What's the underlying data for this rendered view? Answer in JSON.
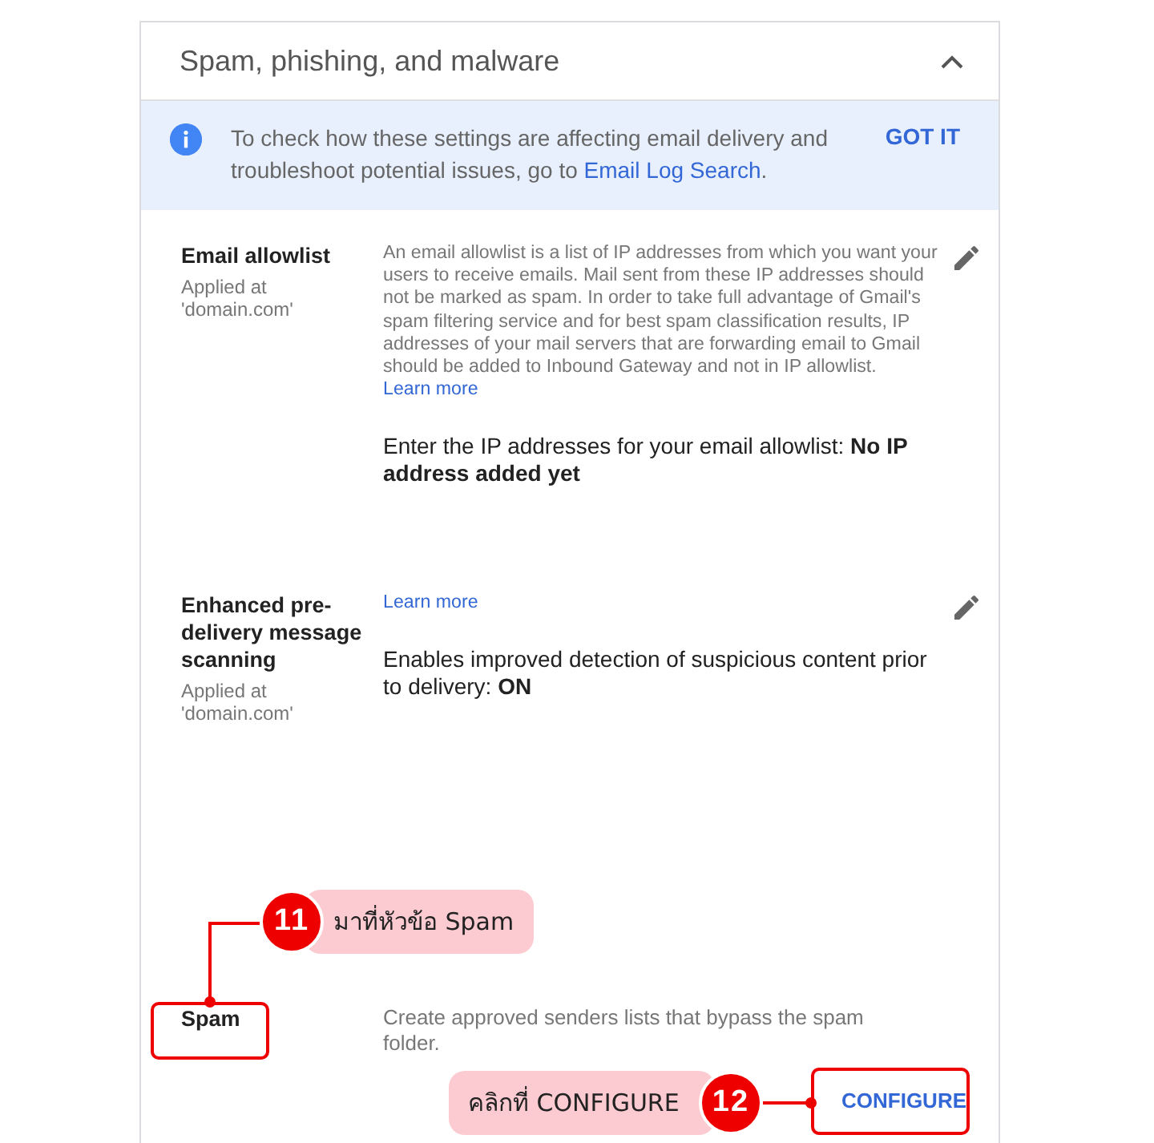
{
  "section": {
    "title": "Spam, phishing, and malware",
    "expanded": true
  },
  "banner": {
    "text": "To check how these settings are affecting email delivery and troubleshoot potential issues, go to ",
    "link": "Email Log Search",
    "end": ".",
    "action": "GOT IT"
  },
  "settings": [
    {
      "title": "Email allowlist",
      "applied": "Applied at 'domain.com'",
      "description": "An email allowlist is a list of IP addresses from which you want your users to receive emails. Mail sent from these IP addresses should not be marked as spam. In order to take full advantage of Gmail's spam filtering service and for best spam classification results, IP addresses of your mail servers that are forwarding email to Gmail should be added to Inbound Gateway and not in IP allowlist.",
      "learn_more": "Learn more",
      "value": "Enter the IP addresses for your email allowlist: **No IP address added yet**",
      "editable": true
    },
    {
      "title": "Enhanced pre-delivery message scanning",
      "applied": "Applied at 'domain.com'",
      "learn_more": "Learn more",
      "value": "Enables improved detection of suspicious content prior to delivery: **ON**",
      "editable": true
    },
    {
      "title": "Spam",
      "description": "Create approved senders lists that bypass the spam folder.",
      "button": "CONFIGURE"
    }
  ],
  "annotations": [
    {
      "number": "11",
      "text": "มาที่หัวข้อ Spam"
    },
    {
      "number": "12",
      "text": "คลิกที่ CONFIGURE"
    }
  ]
}
